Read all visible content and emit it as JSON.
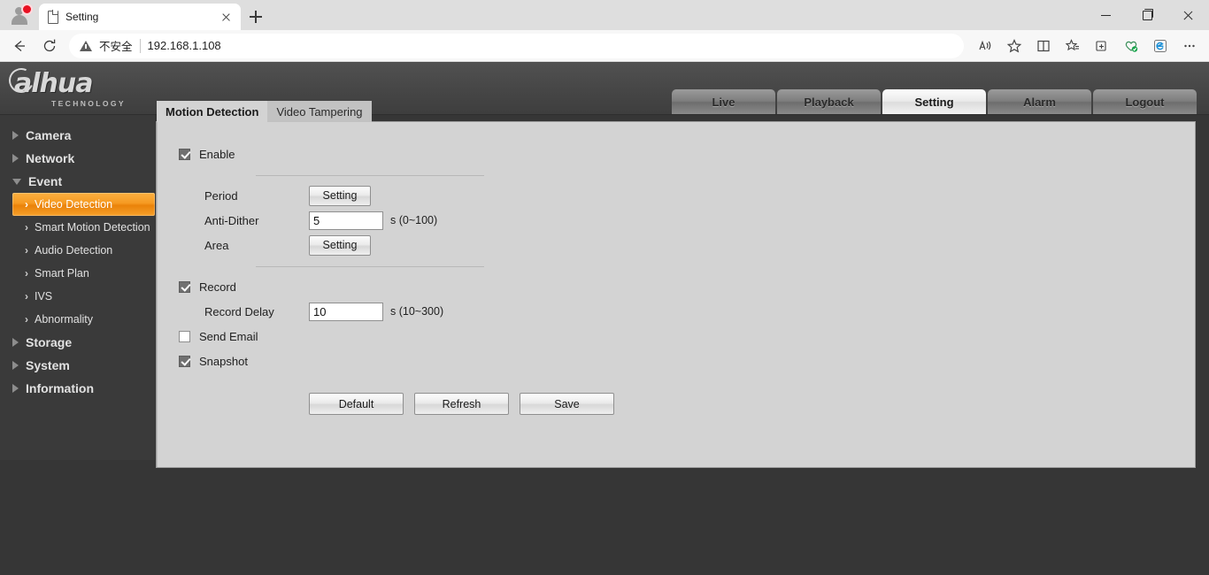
{
  "browser": {
    "profile_icon": "avatar-icon",
    "tab": {
      "title": "Setting",
      "favicon": "page-icon",
      "close_icon": "close-icon"
    },
    "new_tab_icon": "plus-icon",
    "window_controls": {
      "minimize": "minimize-icon",
      "maximize": "maximize-icon",
      "close": "close-icon"
    },
    "nav": {
      "back_icon": "back-arrow-icon",
      "reload_icon": "reload-icon"
    },
    "omnibox": {
      "security_icon": "warning-triangle-icon",
      "security_text": "不安全",
      "url": "192.168.1.108"
    },
    "toolbar_icons": [
      "read-aloud-icon",
      "favorite-star-icon",
      "split-screen-icon",
      "favorites-list-icon",
      "collections-add-icon",
      "browser-essentials-icon",
      "ie-mode-icon",
      "settings-more-icon"
    ]
  },
  "app": {
    "logo": {
      "word": "alhua",
      "subtitle": "TECHNOLOGY"
    },
    "nav_tabs": [
      {
        "label": "Live",
        "active": false
      },
      {
        "label": "Playback",
        "active": false
      },
      {
        "label": "Setting",
        "active": true
      },
      {
        "label": "Alarm",
        "active": false
      },
      {
        "label": "Logout",
        "active": false
      }
    ],
    "sidebar": [
      {
        "label": "Camera",
        "type": "top",
        "expanded": false
      },
      {
        "label": "Network",
        "type": "top",
        "expanded": false
      },
      {
        "label": "Event",
        "type": "top",
        "expanded": true
      },
      {
        "label": "Video Detection",
        "type": "sub",
        "selected": true
      },
      {
        "label": "Smart Motion Detection",
        "type": "sub",
        "selected": false
      },
      {
        "label": "Audio Detection",
        "type": "sub",
        "selected": false
      },
      {
        "label": "Smart Plan",
        "type": "sub",
        "selected": false
      },
      {
        "label": "IVS",
        "type": "sub",
        "selected": false
      },
      {
        "label": "Abnormality",
        "type": "sub",
        "selected": false
      },
      {
        "label": "Storage",
        "type": "top",
        "expanded": false
      },
      {
        "label": "System",
        "type": "top",
        "expanded": false
      },
      {
        "label": "Information",
        "type": "top",
        "expanded": false
      }
    ],
    "content_tabs": [
      {
        "label": "Motion Detection",
        "active": true
      },
      {
        "label": "Video Tampering",
        "active": false
      }
    ],
    "form": {
      "enable": {
        "label": "Enable",
        "checked": true
      },
      "period": {
        "label": "Period",
        "button": "Setting"
      },
      "anti_dither": {
        "label": "Anti-Dither",
        "value": "5",
        "hint": "s (0~100)"
      },
      "area": {
        "label": "Area",
        "button": "Setting"
      },
      "record": {
        "label": "Record",
        "checked": true
      },
      "record_delay": {
        "label": "Record Delay",
        "value": "10",
        "hint": "s (10~300)"
      },
      "send_email": {
        "label": "Send Email",
        "checked": false
      },
      "snapshot": {
        "label": "Snapshot",
        "checked": true
      },
      "actions": {
        "default": "Default",
        "refresh": "Refresh",
        "save": "Save"
      }
    }
  },
  "colors": {
    "accent_orange": "#f59a22",
    "app_dark": "#363636",
    "sidebar": "#3a3a3a",
    "panel": "#d3d3d3"
  }
}
